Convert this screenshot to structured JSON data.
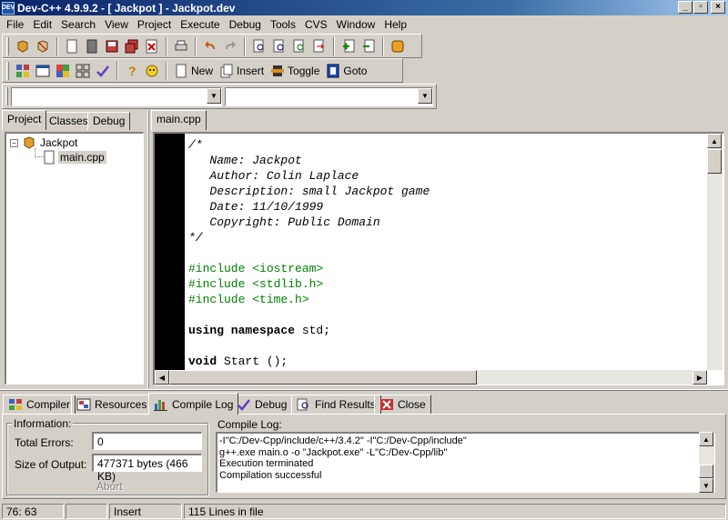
{
  "window": {
    "title": "Dev-C++ 4.9.9.2  -  [ Jackpot ] - Jackpot.dev",
    "app_icon_text": "DEV"
  },
  "menu": [
    "File",
    "Edit",
    "Search",
    "View",
    "Project",
    "Execute",
    "Debug",
    "Tools",
    "CVS",
    "Window",
    "Help"
  ],
  "toolbar2": {
    "new_label": "New",
    "insert_label": "Insert",
    "toggle_label": "Toggle",
    "goto_label": "Goto"
  },
  "left_tabs": [
    "Project",
    "Classes",
    "Debug"
  ],
  "tree": {
    "root": "Jackpot",
    "file": "main.cpp"
  },
  "editor": {
    "tab": "main.cpp",
    "lines": [
      {
        "t": "/*",
        "c": "cm"
      },
      {
        "t": "   Name: Jackpot",
        "c": "cm"
      },
      {
        "t": "   Author: Colin Laplace",
        "c": "cm"
      },
      {
        "t": "   Description: small Jackpot game",
        "c": "cm"
      },
      {
        "t": "   Date: 11/10/1999",
        "c": "cm"
      },
      {
        "t": "   Copyright: Public Domain",
        "c": "cm"
      },
      {
        "t": "*/",
        "c": "cm"
      },
      {
        "t": "",
        "c": ""
      },
      {
        "t": "#include <iostream>",
        "c": "pp"
      },
      {
        "t": "#include <stdlib.h>",
        "c": "pp"
      },
      {
        "t": "#include <time.h>",
        "c": "pp"
      },
      {
        "t": "",
        "c": ""
      },
      {
        "t": "using namespace std;",
        "c": "using"
      },
      {
        "t": "",
        "c": ""
      },
      {
        "t": "void Start ();",
        "c": "void"
      }
    ]
  },
  "bottom_tabs": [
    "Compiler",
    "Resources",
    "Compile Log",
    "Debug",
    "Find Results",
    "Close"
  ],
  "info": {
    "group_label": "Information:",
    "total_errors_label": "Total Errors:",
    "total_errors": "0",
    "size_label": "Size of Output:",
    "size": "477371 bytes (466 KB)",
    "abort_label": "Abort"
  },
  "compile_log": {
    "label": "Compile Log:",
    "lines": [
      "-I\"C:/Dev-Cpp/include/c++/3.4.2\"  -I\"C:/Dev-Cpp/include\"",
      "g++.exe main.o  -o \"Jackpot.exe\" -L\"C:/Dev-Cpp/lib\"",
      "Execution terminated",
      "Compilation successful"
    ]
  },
  "status": {
    "position": "76: 63",
    "mode": "Insert",
    "lines": "115 Lines in file"
  }
}
